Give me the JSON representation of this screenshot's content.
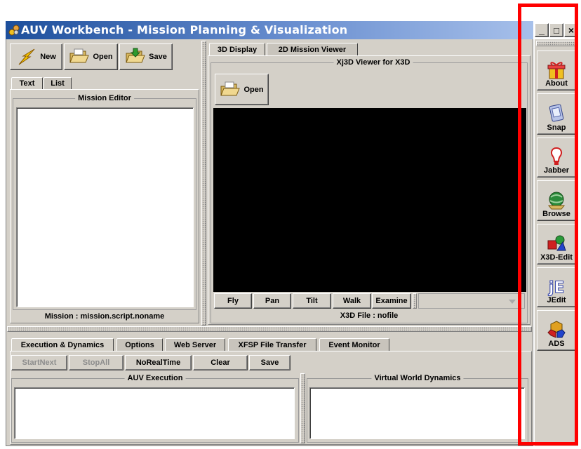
{
  "window": {
    "title": "AUV Workbench - Mission Planning & Visualization",
    "controls": [
      "_",
      "□",
      "×"
    ]
  },
  "mission_panel": {
    "toolbar": {
      "new_label": "New",
      "open_label": "Open",
      "save_label": "Save"
    },
    "tabs": [
      "Text",
      "List"
    ],
    "editor_title": "Mission Editor",
    "status": "Mission : mission.script.noname"
  },
  "viewer_panel": {
    "tabs": [
      "3D Display",
      "2D Mission Viewer"
    ],
    "group_title": "Xj3D Viewer for X3D",
    "open_label": "Open",
    "nav_buttons": [
      "Fly",
      "Pan",
      "Tilt",
      "Walk",
      "Examine"
    ],
    "status": "X3D File : nofile"
  },
  "bottom_panel": {
    "tabs": [
      "Execution & Dynamics",
      "Options",
      "Web Server",
      "XFSP File Transfer",
      "Event Monitor"
    ],
    "buttons": {
      "startnext": "StartNext",
      "stopall": "StopAll",
      "norealtime": "NoRealTime",
      "clear": "Clear",
      "save": "Save"
    },
    "auv_execution_title": "AUV Execution",
    "virtual_world_title": "Virtual World Dynamics"
  },
  "side_toolbar": {
    "buttons": [
      "About",
      "Snap",
      "Jabber",
      "Browse",
      "X3D-Edit",
      "JEdit",
      "ADS"
    ]
  },
  "highlight_color": "#ff0000"
}
